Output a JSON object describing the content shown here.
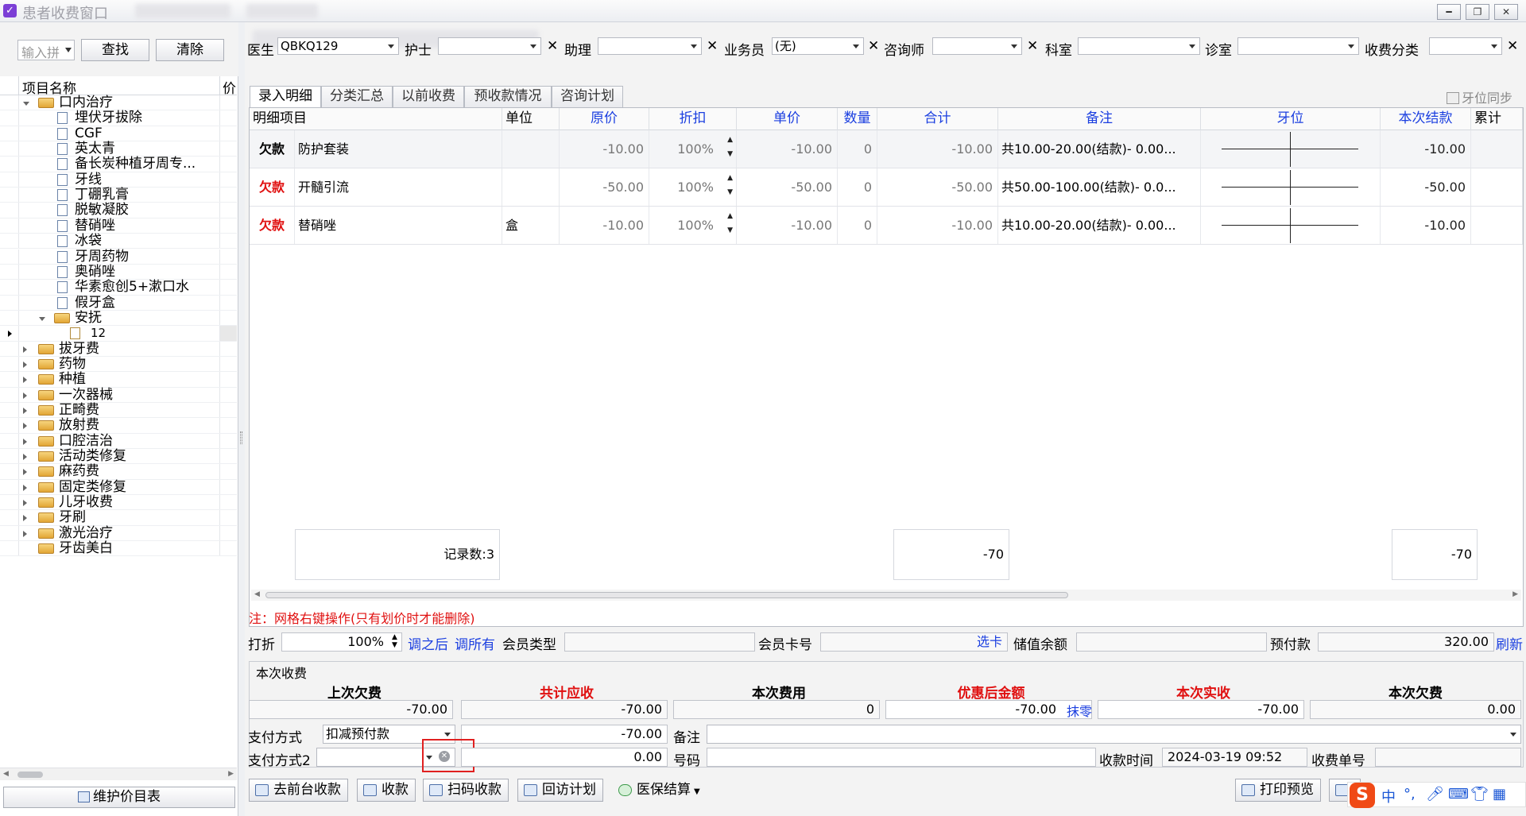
{
  "window": {
    "title": "患者收费窗口"
  },
  "left": {
    "search_placeholder": "输入拼",
    "find_label": "查找",
    "clear_label": "清除",
    "col_name": "项目名称",
    "col_price": "价",
    "tree": [
      {
        "label": "口内治疗",
        "level": 0,
        "type": "folder",
        "expanded": true
      },
      {
        "label": "埋伏牙拔除",
        "level": 1,
        "type": "doc"
      },
      {
        "label": "CGF",
        "level": 1,
        "type": "doc"
      },
      {
        "label": "英太青",
        "level": 1,
        "type": "doc"
      },
      {
        "label": "备长炭种植牙周专...",
        "level": 1,
        "type": "doc"
      },
      {
        "label": "牙线",
        "level": 1,
        "type": "doc"
      },
      {
        "label": "丁硼乳膏",
        "level": 1,
        "type": "doc"
      },
      {
        "label": "脱敏凝胶",
        "level": 1,
        "type": "doc"
      },
      {
        "label": "替硝唑",
        "level": 1,
        "type": "doc"
      },
      {
        "label": "冰袋",
        "level": 1,
        "type": "doc"
      },
      {
        "label": "牙周药物",
        "level": 1,
        "type": "doc"
      },
      {
        "label": "奥硝唑",
        "level": 1,
        "type": "doc"
      },
      {
        "label": "华素愈创5+漱口水",
        "level": 1,
        "type": "doc"
      },
      {
        "label": "假牙盒",
        "level": 1,
        "type": "doc"
      },
      {
        "label": "安抚",
        "level": 1,
        "type": "folder",
        "expanded": true
      },
      {
        "label": "12",
        "level": 2,
        "type": "edit",
        "selected": true
      },
      {
        "label": "拔牙费",
        "level": 0,
        "type": "folder"
      },
      {
        "label": "药物",
        "level": 0,
        "type": "folder"
      },
      {
        "label": "种植",
        "level": 0,
        "type": "folder"
      },
      {
        "label": "一次器械",
        "level": 0,
        "type": "folder"
      },
      {
        "label": "正畸费",
        "level": 0,
        "type": "folder"
      },
      {
        "label": "放射费",
        "level": 0,
        "type": "folder"
      },
      {
        "label": "口腔洁治",
        "level": 0,
        "type": "folder"
      },
      {
        "label": "活动类修复",
        "level": 0,
        "type": "folder"
      },
      {
        "label": "麻药费",
        "level": 0,
        "type": "folder"
      },
      {
        "label": "固定类修复",
        "level": 0,
        "type": "folder"
      },
      {
        "label": "儿牙收费",
        "level": 0,
        "type": "folder"
      },
      {
        "label": "牙刷",
        "level": 0,
        "type": "folder"
      },
      {
        "label": "激光治疗",
        "level": 0,
        "type": "folder"
      },
      {
        "label": "牙齿美白",
        "level": 0,
        "type": "folder",
        "noexp": true
      }
    ],
    "maintain_label": "维护价目表"
  },
  "filters": {
    "doctor_label": "医生",
    "doctor_value": "QBKQ129",
    "nurse_label": "护士",
    "assistant_label": "助理",
    "salesman_label": "业务员",
    "salesman_value": "(无)",
    "consultant_label": "咨询师",
    "dept_label": "科室",
    "clinic_label": "诊室",
    "category_label": "收费分类"
  },
  "tabs": [
    "录入明细",
    "分类汇总",
    "以前收费",
    "预收款情况",
    "咨询计划"
  ],
  "sync_label": "牙位同步",
  "grid": {
    "headers": [
      "明细项目",
      "单位",
      "原价",
      "折扣",
      "单价",
      "数量",
      "合计",
      "备注",
      "牙位",
      "本次结款",
      "累计"
    ],
    "rows": [
      {
        "status": "欠款",
        "name": "防护套装",
        "unit": "",
        "orig": "-10.00",
        "disc": "100%",
        "price": "-10.00",
        "qty": "0",
        "total": "-10.00",
        "remark": "共10.00-20.00(结款)- 0.00...",
        "pay": "-10.00"
      },
      {
        "status": "欠款",
        "name": "开髓引流",
        "unit": "",
        "orig": "-50.00",
        "disc": "100%",
        "price": "-50.00",
        "qty": "0",
        "total": "-50.00",
        "remark": "共50.00-100.00(结款)- 0.0...",
        "pay": "-50.00"
      },
      {
        "status": "欠款",
        "name": "替硝唑",
        "unit": "盒",
        "orig": "-10.00",
        "disc": "100%",
        "price": "-10.00",
        "qty": "0",
        "total": "-10.00",
        "remark": "共10.00-20.00(结款)- 0.00...",
        "pay": "-10.00"
      }
    ],
    "record_count": "记录数:3",
    "sum_total": "-70",
    "sum_pay": "-70"
  },
  "note": "注：网格右键操作(只有划价时才能删除)",
  "discount": {
    "label": "打折",
    "value": "100%",
    "adjust_after": "调之后",
    "adjust_all": "调所有",
    "member_type_label": "会员类型",
    "member_card_label": "会员卡号",
    "select_card": "选卡",
    "balance_label": "储值余额",
    "prepaid_label": "预付款",
    "prepaid_value": "320.00",
    "refresh": "刷新"
  },
  "charge": {
    "section_title": "本次收费",
    "cols": [
      "上次欠费",
      "共计应收",
      "本次费用",
      "优惠后金额",
      "本次实收",
      "本次欠费"
    ],
    "values": [
      "-70.00",
      "-70.00",
      "0",
      "-70.00",
      "-70.00",
      "0.00"
    ],
    "round_off": "抹零",
    "pay_method_label": "支付方式",
    "pay_method_value": "扣减预付款",
    "pay_amount": "-70.00",
    "remark_label": "备注",
    "pay_method2_label": "支付方式2",
    "pay_amount2": "0.00",
    "number_label": "号码",
    "time_label": "收款时间",
    "time_value": "2024-03-19 09:52",
    "receipt_label": "收费单号"
  },
  "buttons": {
    "front_desk": "去前台收款",
    "charge": "收款",
    "scan": "扫码收款",
    "revisit": "回访计划",
    "insurance": "医保结算",
    "print_preview": "打印预览"
  },
  "ime": {
    "lang": "中"
  }
}
